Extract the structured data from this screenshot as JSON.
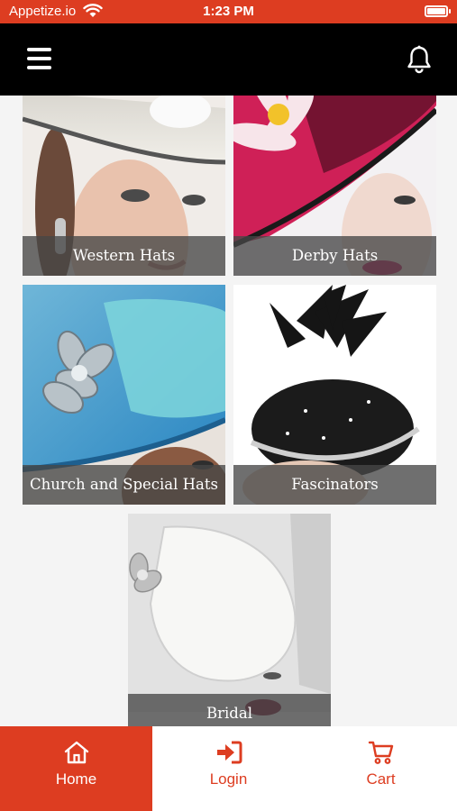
{
  "status_bar": {
    "carrier": "Appetize.io",
    "time": "1:23 PM"
  },
  "nav": {
    "menu_icon": "hamburger-menu-icon",
    "notification_icon": "bell-icon"
  },
  "categories": [
    {
      "label": "Western Hats"
    },
    {
      "label": "Derby Hats"
    },
    {
      "label": "Church and Special Hats"
    },
    {
      "label": "Fascinators"
    },
    {
      "label": "Bridal"
    }
  ],
  "tabs": [
    {
      "label": "Home",
      "icon": "home-icon",
      "active": true
    },
    {
      "label": "Login",
      "icon": "sign-in-icon",
      "active": false
    },
    {
      "label": "Cart",
      "icon": "cart-icon",
      "active": false
    }
  ],
  "colors": {
    "accent": "#dd3d21",
    "nav_background": "#000000",
    "page_background": "#f4f4f4"
  }
}
